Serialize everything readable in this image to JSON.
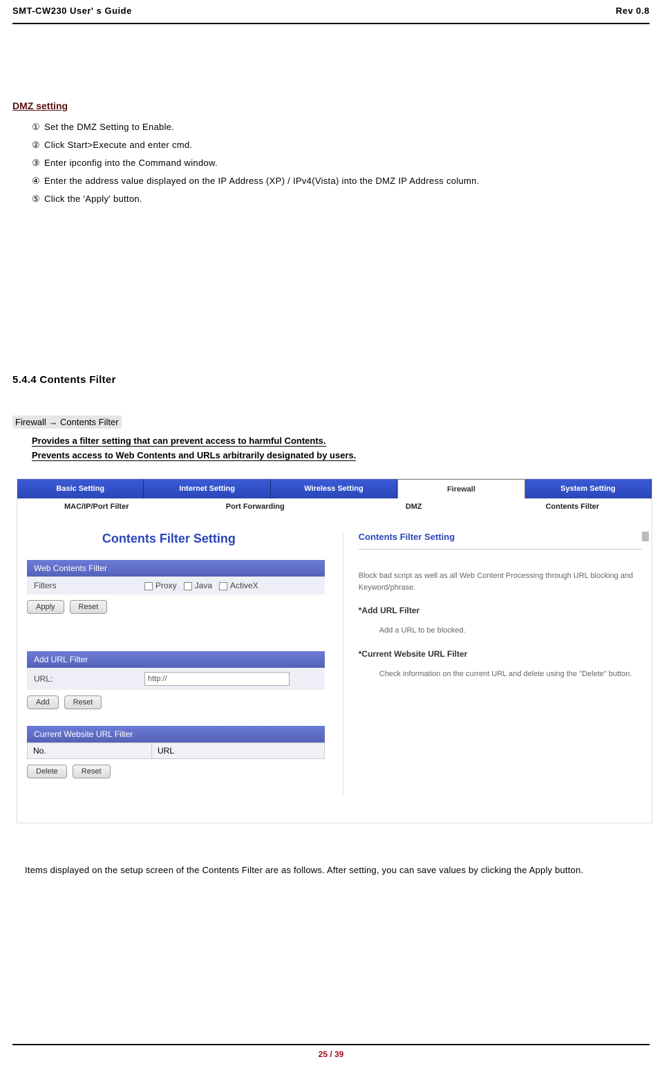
{
  "header": {
    "left": "SMT-CW230 User' s Guide",
    "right": "Rev 0.8"
  },
  "dmz": {
    "title": "DMZ setting",
    "steps": [
      "Set the DMZ Setting to Enable.",
      "Click Start>Execute and enter cmd.",
      "Enter ipconfig into the Command window.",
      "Enter the address value displayed on the IP Address (XP) / IPv4(Vista) into the DMZ IP Address  column.",
      "Click the  'Apply'  button."
    ],
    "nums": [
      "①",
      "②",
      "③",
      "④",
      "⑤"
    ]
  },
  "section_heading": "5.4.4 Contents Filter",
  "path": "Firewall → Contents Filter",
  "desc": [
    "Provides a filter setting that can prevent access to harmful Contents.",
    "Prevents access to Web Contents and URLs arbitrarily designated by users."
  ],
  "panel": {
    "tabs": [
      "Basic Setting",
      "Internet Setting",
      "Wireless Setting",
      "Firewall",
      "System Setting"
    ],
    "subtabs": [
      "MAC/IP/Port Filter",
      "Port Forwarding",
      "DMZ",
      "Contents Filter"
    ],
    "title": "Contents Filter Setting",
    "wcf": {
      "header": "Web Contents Filter",
      "row_label": "Filters",
      "opts": [
        "Proxy",
        "Java",
        "ActiveX"
      ]
    },
    "btn_apply": "Apply",
    "btn_reset": "Reset",
    "addurl": {
      "header": "Add URL Filter",
      "row_label": "URL:",
      "value": "http://"
    },
    "btn_add": "Add",
    "cur": {
      "header": "Current Website URL Filter",
      "col1": "No.",
      "col2": "URL"
    },
    "btn_delete": "Delete",
    "help": {
      "title": "Contents Filter Setting",
      "p1": "Block bad script as well as all Web Content Processing through URL blocking and Keyword/phrase.",
      "sub1": "*Add URL Filter",
      "ind1": "Add a URL to be blocked.",
      "sub2": "*Current Website URL Filter",
      "ind2": "Check information on the current URL and delete using the \"Delete\" button."
    }
  },
  "bottom_note": "Items displayed on the setup screen of the Contents Filter are as follows. After setting, you can save values by clicking the Apply button.",
  "footer": "25 / 39"
}
